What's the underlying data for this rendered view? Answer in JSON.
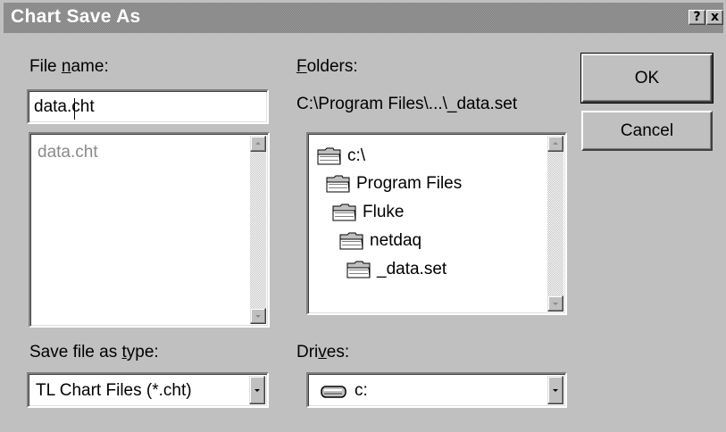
{
  "title": "Chart Save As",
  "title_buttons": {
    "help": "?",
    "close": "x"
  },
  "filename": {
    "label_pre": "File ",
    "label_key": "n",
    "label_post": "ame:",
    "value": "data.cht",
    "files": [
      "data.cht"
    ]
  },
  "folders": {
    "label_key": "F",
    "label_post": "olders:",
    "current_path": "C:\\Program Files\\...\\_data.set",
    "tree": [
      "c:\\",
      "Program Files",
      "Fluke",
      "netdaq",
      "_data.set"
    ]
  },
  "buttons": {
    "ok": "OK",
    "cancel": "Cancel"
  },
  "save_type": {
    "label_pre": "Save file as ",
    "label_key": "t",
    "label_post": "ype:",
    "value": "TL Chart Files (*.cht)"
  },
  "drives": {
    "label_pre": "Dri",
    "label_key": "v",
    "label_post": "es:",
    "value": "c:"
  },
  "icons": {
    "folder": "open-folder-icon",
    "drive": "hard-drive-icon",
    "scroll_up": "scroll-up-arrow-icon",
    "scroll_down": "scroll-down-arrow-icon",
    "dropdown": "dropdown-arrow-icon"
  },
  "colors": {
    "face": "#c0c0c0",
    "caption": "#808080",
    "caption_text": "#ffffff",
    "disabled_text": "#8a8a8a"
  }
}
